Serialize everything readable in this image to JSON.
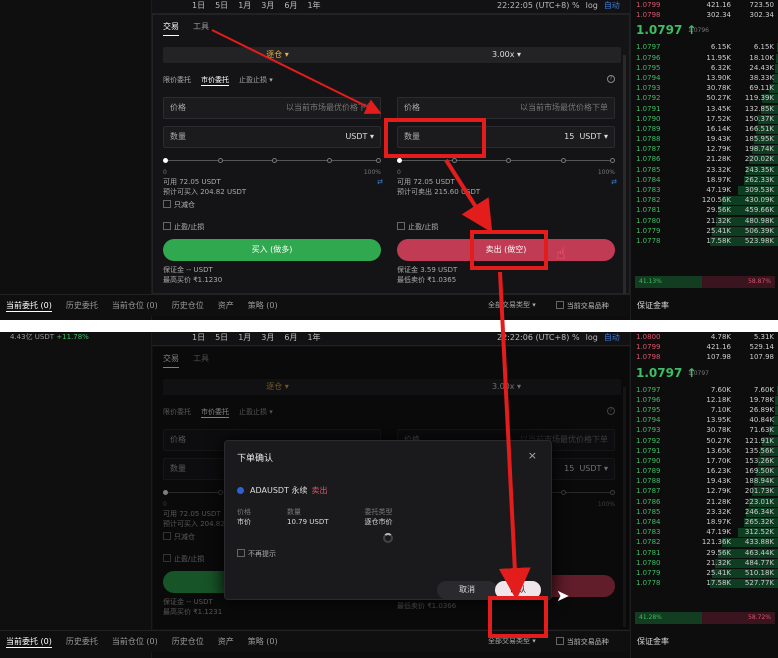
{
  "colors": {
    "buy": "#2fa84f",
    "sell": "#c23b54",
    "annotation": "#e31c1c",
    "accent": "#3a7bd5"
  },
  "timebar": {
    "intervals": [
      "1日",
      "5日",
      "1月",
      "3月",
      "6月",
      "1年"
    ],
    "time1": "22:22:05 (UTC+8)",
    "time2": "22:22:06 (UTC+8)",
    "pct": "%",
    "log": "log",
    "auto": "自动"
  },
  "trade": {
    "tabs": [
      "交易",
      "工具"
    ],
    "mode_left": "逐仓",
    "leverage": "3.00x",
    "order_tabs": [
      "限价委托",
      "市价委托",
      "止盈止损"
    ],
    "left": {
      "price_label": "价格",
      "price_hint": "以当前市场最优价格下单",
      "qty_label": "数量",
      "qty_unit": "USDT",
      "pct_start": "0",
      "pct_end": "100%",
      "avail": "可用 72.05 USDT",
      "can_buy": "预计可买入 204.82 USDT",
      "reduce_only": "只减仓",
      "tpsl": "止盈/止损",
      "buy_btn": "买入 (做多)",
      "margin": "保证金 -- USDT",
      "liq1": "最高买价 ₹1.1230",
      "liq2": "最高买价 ₹1.1231"
    },
    "right": {
      "price_label": "价格",
      "price_hint": "以当前市场最优价格下单",
      "qty_label": "数量",
      "qty_value": "15",
      "qty_unit": "USDT",
      "pct_start": "0",
      "pct_end": "100%",
      "avail": "可用 72.05 USDT",
      "can_sell": "预计可卖出 215.60 USDT",
      "tpsl": "止盈/止损",
      "sell_btn": "卖出 (做空)",
      "margin": "保证金 3.59 USDT",
      "liq1": "最低卖价 ₹1.0365",
      "liq2": "最低卖价 ₹1.0366"
    }
  },
  "bottom": {
    "tabs": [
      "当前委托 (0)",
      "历史委托",
      "当前仓位 (0)",
      "历史仓位",
      "资产",
      "策略 (0)"
    ],
    "filter": "全部交易类型",
    "current_symbol": "当前交易品种",
    "margin_rate": "保证金率"
  },
  "book1": {
    "asks": [
      [
        "1.0799",
        "421.16",
        "723.50"
      ],
      [
        "1.0798",
        "302.34",
        "302.34"
      ]
    ],
    "mid": "1.0797",
    "mid_arrow": "↑",
    "mid_sub": "1.0796",
    "bids": [
      [
        "1.0797",
        "6.15K",
        "6.15K",
        4
      ],
      [
        "1.0796",
        "11.95K",
        "18.10K",
        12
      ],
      [
        "1.0795",
        "6.32K",
        "24.43K",
        16
      ],
      [
        "1.0794",
        "13.90K",
        "38.33K",
        25
      ],
      [
        "1.0793",
        "30.78K",
        "69.11K",
        45
      ],
      [
        "1.0792",
        "50.27K",
        "119.39K",
        78
      ],
      [
        "1.0791",
        "13.45K",
        "132.85K",
        86
      ],
      [
        "1.0790",
        "17.52K",
        "150.37K",
        98
      ],
      [
        "1.0789",
        "16.14K",
        "166.51K",
        108
      ],
      [
        "1.0788",
        "19.43K",
        "185.95K",
        120
      ],
      [
        "1.0787",
        "12.79K",
        "198.74K",
        129
      ],
      [
        "1.0786",
        "21.28K",
        "220.02K",
        143
      ],
      [
        "1.0785",
        "23.32K",
        "243.35K",
        158
      ],
      [
        "1.0784",
        "18.97K",
        "262.33K",
        170
      ],
      [
        "1.0783",
        "47.19K",
        "309.53K",
        200
      ],
      [
        "1.0782",
        "120.56K",
        "430.09K",
        279
      ],
      [
        "1.0781",
        "29.56K",
        "459.66K",
        298
      ],
      [
        "1.0780",
        "21.32K",
        "480.98K",
        312
      ],
      [
        "1.0779",
        "25.41K",
        "506.39K",
        328
      ],
      [
        "1.0778",
        "17.58K",
        "523.98K",
        340
      ]
    ],
    "buy_ratio": "41.13%",
    "sell_ratio": "58.87%"
  },
  "book2": {
    "asks": [
      [
        "1.0800",
        "4.78K",
        "5.31K"
      ],
      [
        "1.0799",
        "421.16",
        "529.14"
      ],
      [
        "1.0798",
        "107.98",
        "107.98"
      ]
    ],
    "mid": "1.0797",
    "mid_arrow": "↑",
    "mid_sub": "1.0797",
    "bids": [
      [
        "1.0797",
        "7.60K",
        "7.60K",
        5
      ],
      [
        "1.0796",
        "12.18K",
        "19.78K",
        13
      ],
      [
        "1.0795",
        "7.10K",
        "26.89K",
        17
      ],
      [
        "1.0794",
        "13.95K",
        "40.84K",
        26
      ],
      [
        "1.0793",
        "30.78K",
        "71.63K",
        46
      ],
      [
        "1.0792",
        "50.27K",
        "121.91K",
        79
      ],
      [
        "1.0791",
        "13.65K",
        "135.56K",
        88
      ],
      [
        "1.0790",
        "17.70K",
        "153.26K",
        99
      ],
      [
        "1.0789",
        "16.23K",
        "169.50K",
        110
      ],
      [
        "1.0788",
        "19.43K",
        "188.94K",
        122
      ],
      [
        "1.0787",
        "12.79K",
        "201.73K",
        131
      ],
      [
        "1.0786",
        "21.28K",
        "223.01K",
        144
      ],
      [
        "1.0785",
        "23.32K",
        "246.34K",
        160
      ],
      [
        "1.0784",
        "18.97K",
        "265.32K",
        172
      ],
      [
        "1.0783",
        "47.19K",
        "312.52K",
        202
      ],
      [
        "1.0782",
        "121.36K",
        "433.88K",
        281
      ],
      [
        "1.0781",
        "29.56K",
        "463.44K",
        300
      ],
      [
        "1.0780",
        "21.32K",
        "484.77K",
        314
      ],
      [
        "1.0779",
        "25.41K",
        "510.18K",
        331
      ],
      [
        "1.0778",
        "17.58K",
        "527.77K",
        342
      ]
    ],
    "buy_ratio": "41.28%",
    "sell_ratio": "58.72%"
  },
  "left_ticker": {
    "value": "4.43亿 USDT",
    "change": "+11.78%"
  },
  "modal": {
    "title": "下单确认",
    "close": "×",
    "symbol": "ADAUSDT 永续",
    "side": "卖出",
    "labels": [
      "价格",
      "数量",
      "委托类型"
    ],
    "values": [
      "市价",
      "10.79 USDT",
      "逐仓市价"
    ],
    "no_remind": "不再提示",
    "cancel": "取消",
    "confirm": "确认"
  }
}
